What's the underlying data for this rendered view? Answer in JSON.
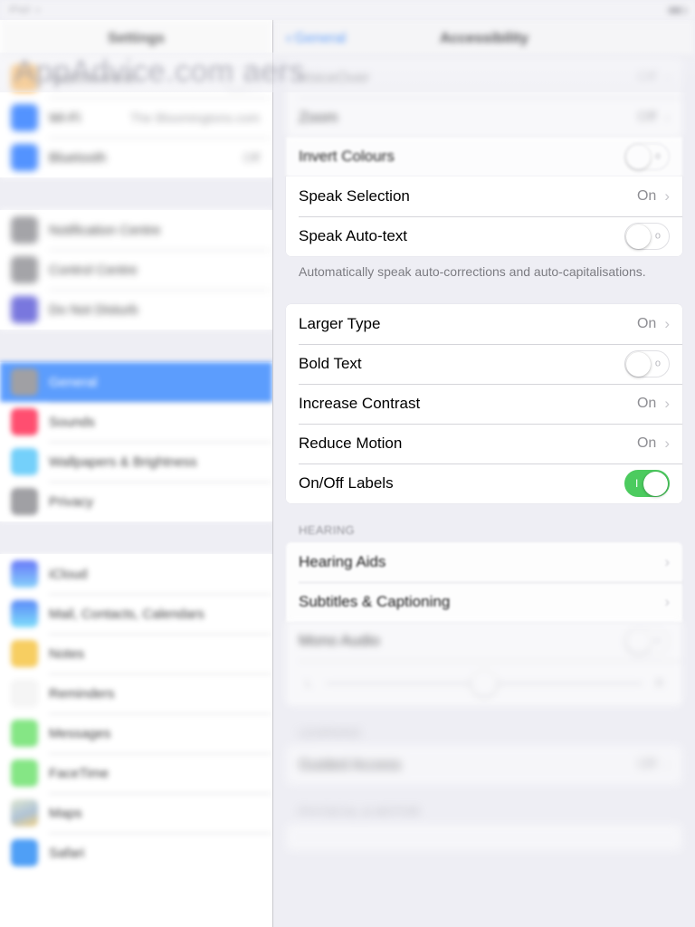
{
  "status_bar": {
    "left_text": "iPad",
    "center_text": "",
    "right_text": "",
    "battery_icon": "battery-icon",
    "wifi_icon": "wifi-icon"
  },
  "watermark": {
    "text": "AppAdvice.com aers"
  },
  "sidebar": {
    "title": "Settings",
    "groups": [
      {
        "items": [
          {
            "label": "Airplane Mode",
            "icon": "airplane-icon",
            "color": "#FF9500",
            "control": "toggle",
            "toggle_on": false,
            "detail": ""
          },
          {
            "label": "Wi-Fi",
            "icon": "wifi-icon",
            "color": "#2979FF",
            "control": "detail",
            "detail": "The Bloomingtons.com"
          },
          {
            "label": "Bluetooth",
            "icon": "bluetooth-icon",
            "color": "#2979FF",
            "control": "detail",
            "detail": "Off"
          }
        ]
      },
      {
        "items": [
          {
            "label": "Notification Centre",
            "icon": "notification-centre-icon",
            "color": "#8E8E93",
            "control": "none",
            "detail": ""
          },
          {
            "label": "Control Centre",
            "icon": "control-centre-icon",
            "color": "#8E8E93",
            "control": "none",
            "detail": ""
          },
          {
            "label": "Do Not Disturb",
            "icon": "do-not-disturb-icon",
            "color": "#5856D6",
            "control": "none",
            "detail": ""
          }
        ]
      },
      {
        "items": [
          {
            "label": "General",
            "icon": "gear-icon",
            "color": "#8E8E93",
            "control": "none",
            "detail": "",
            "selected": true
          },
          {
            "label": "Sounds",
            "icon": "sounds-icon",
            "color": "#FF2D55",
            "control": "none",
            "detail": ""
          },
          {
            "label": "Wallpapers & Brightness",
            "icon": "wallpaper-icon",
            "color": "#5AC8FA",
            "control": "none",
            "detail": ""
          },
          {
            "label": "Privacy",
            "icon": "privacy-hand-icon",
            "color": "#8E8E93",
            "control": "none",
            "detail": ""
          }
        ]
      },
      {
        "items": [
          {
            "label": "iCloud",
            "icon": "icloud-icon",
            "color": "#3B5BFD",
            "control": "none",
            "detail": ""
          },
          {
            "label": "Mail, Contacts, Calendars",
            "icon": "mail-icon",
            "color": "#41C9F5",
            "control": "none",
            "detail": ""
          },
          {
            "label": "Notes",
            "icon": "notes-icon",
            "color": "#F6C544",
            "control": "none",
            "detail": ""
          },
          {
            "label": "Reminders",
            "icon": "reminders-icon",
            "color": "#F2F2F2",
            "control": "none",
            "detail": ""
          },
          {
            "label": "Messages",
            "icon": "messages-icon",
            "color": "#6EE26E",
            "control": "none",
            "detail": ""
          },
          {
            "label": "FaceTime",
            "icon": "facetime-icon",
            "color": "#6EE26E",
            "control": "none",
            "detail": ""
          },
          {
            "label": "Maps",
            "icon": "maps-icon",
            "color": "#C9D8A8",
            "control": "none",
            "detail": ""
          },
          {
            "label": "Safari",
            "icon": "safari-icon",
            "color": "#2E8DF5",
            "control": "none",
            "detail": ""
          }
        ]
      }
    ]
  },
  "detail": {
    "back_label": "General",
    "back_icon": "chevron-left-icon",
    "title": "Accessibility",
    "section_vision": {
      "rows": [
        {
          "label": "VoiceOver",
          "control": "detail",
          "value": "Off",
          "chevron": true
        },
        {
          "label": "Zoom",
          "control": "detail",
          "value": "Off",
          "chevron": true
        },
        {
          "label": "Invert Colours",
          "control": "toggle",
          "toggle_on": false
        },
        {
          "label": "Speak Selection",
          "control": "detail",
          "value": "On",
          "chevron": true
        },
        {
          "label": "Speak Auto-text",
          "control": "toggle",
          "toggle_on": false
        }
      ],
      "footnote": "Automatically speak auto-corrections and auto-capitalisations."
    },
    "section_type": {
      "rows": [
        {
          "label": "Larger Type",
          "control": "detail",
          "value": "On",
          "chevron": true
        },
        {
          "label": "Bold Text",
          "control": "toggle",
          "toggle_on": false
        },
        {
          "label": "Increase Contrast",
          "control": "detail",
          "value": "On",
          "chevron": true
        },
        {
          "label": "Reduce Motion",
          "control": "detail",
          "value": "On",
          "chevron": true
        },
        {
          "label": "On/Off Labels",
          "control": "toggle",
          "toggle_on": true
        }
      ]
    },
    "section_hearing": {
      "header": "HEARING",
      "rows": [
        {
          "label": "Hearing Aids",
          "control": "chevron",
          "value": "",
          "chevron": true
        },
        {
          "label": "Subtitles & Captioning",
          "control": "chevron",
          "value": "",
          "chevron": true
        },
        {
          "label": "Mono Audio",
          "control": "toggle",
          "toggle_on": false
        }
      ],
      "balance_slider": {
        "left_icon": "speaker-left-icon",
        "right_icon": "speaker-right-icon",
        "value": 50
      }
    },
    "section_learning": {
      "header": "LEARNING",
      "rows": [
        {
          "label": "Guided Access",
          "control": "detail",
          "value": "Off",
          "chevron": true
        }
      ]
    },
    "section_physical": {
      "header": "PHYSICAL & MOTOR"
    },
    "toggle_on_label": "I",
    "toggle_off_label": "o"
  },
  "colors": {
    "accent_blue": "#3e8bfd",
    "toggle_green": "#4ccb5f",
    "page_bg": "#eeeef4",
    "card_bg": "#ffffff",
    "detail_gray": "#8e8e93"
  }
}
